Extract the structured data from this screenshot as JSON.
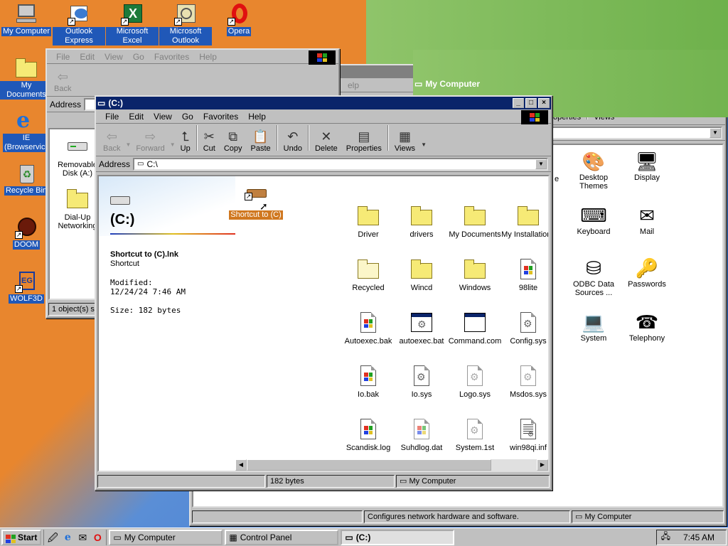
{
  "desktop": {
    "icons": [
      {
        "label": "My Computer"
      },
      {
        "label": "Outlook Express"
      },
      {
        "label": "Microsoft Excel"
      },
      {
        "label": "Microsoft Outlook"
      },
      {
        "label": "Opera"
      },
      {
        "label": "My Documents"
      },
      {
        "label": "IE (Browservice)"
      },
      {
        "label": "Recycle Bin"
      },
      {
        "label": "DOOM"
      },
      {
        "label": "WOLF3D"
      }
    ]
  },
  "mycomputer_window": {
    "title": "My Computer",
    "menu": [
      "File",
      "Edit",
      "View",
      "Go",
      "Favorites",
      "Help"
    ],
    "toolbar": {
      "back": "Back"
    },
    "address_label": "Address",
    "items": [
      "Removable Disk (A:)",
      "Dial-Up Networking"
    ],
    "status": "1 object(s) se"
  },
  "controlpanel_window": {
    "toolbar": {
      "properties": "operties",
      "views": "Views",
      "help": "elp"
    },
    "items": [
      "Desktop Themes",
      "Display",
      "Keyboard",
      "Mail",
      "ODBC Data Sources ...",
      "Passwords",
      "System",
      "Telephony"
    ],
    "status_left": "Configures network hardware and software.",
    "status_right": "My Computer",
    "partial_label": "e"
  },
  "c_window": {
    "title": "(C:)",
    "menu": [
      "File",
      "Edit",
      "View",
      "Go",
      "Favorites",
      "Help"
    ],
    "toolbar": {
      "back": "Back",
      "forward": "Forward",
      "up": "Up",
      "cut": "Cut",
      "copy": "Copy",
      "paste": "Paste",
      "undo": "Undo",
      "delete": "Delete",
      "properties": "Properties",
      "views": "Views"
    },
    "address_label": "Address",
    "address_value": "C:\\",
    "info": {
      "heading": "(C:)",
      "filename": "Shortcut to (C).lnk",
      "filetype": "Shortcut",
      "modified_label": "Modified:",
      "modified_value": "12/24/24 7:46 AM",
      "size": "Size: 182 bytes"
    },
    "selected_item": "Shortcut to (C)",
    "files": [
      "Driver",
      "drivers",
      "My Documents",
      "My Installations",
      "Recycled",
      "Wincd",
      "Windows",
      "98lite",
      "Autoexec.bak",
      "autoexec.bat",
      "Command.com",
      "Config.sys",
      "Io.bak",
      "Io.sys",
      "Logo.sys",
      "Msdos.sys",
      "Scandisk.log",
      "Suhdlog.dat",
      "System.1st",
      "win98qi.inf"
    ],
    "status_size": "182 bytes",
    "status_zone": "My Computer"
  },
  "taskbar": {
    "start": "Start",
    "tasks": [
      "My Computer",
      "Control Panel",
      "(C:)"
    ],
    "clock": "7:45 AM"
  },
  "colors": {
    "active_title": "#0a246a",
    "inactive_title": "#808080",
    "desktop_orange": "#e8862e",
    "desktop_blue": "#2f6fd8"
  }
}
